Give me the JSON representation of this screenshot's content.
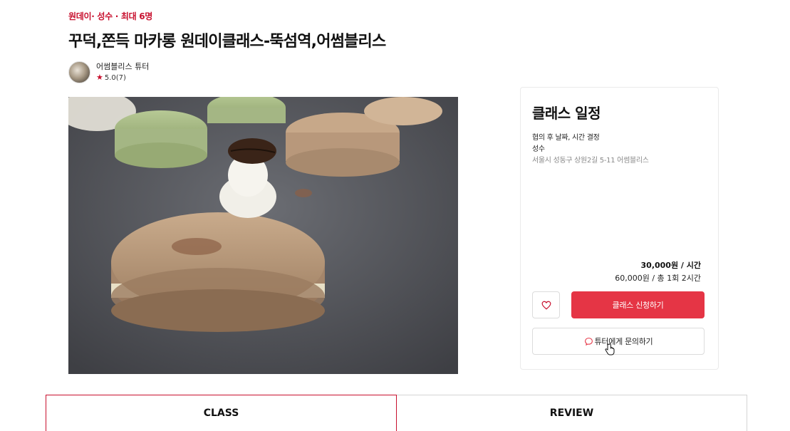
{
  "header": {
    "category": "원데이· 성수 · 최대 6명",
    "title": "꾸덕,쫀득 마카롱 원데이클래스-뚝섬역,어썸블리스"
  },
  "tutor": {
    "name": "어썸블리스 튜터",
    "rating": "5.0(7)"
  },
  "schedule": {
    "title": "클래스 일정",
    "date_note": "협의 후 날짜, 시간 결정",
    "area": "성수",
    "address": "서울시 성동구 상원2길 5-11 어썸블리스",
    "price_per_hour": "30,000원 / 시간",
    "price_total": "60,000원 / 총 1회 2시간",
    "apply_label": "클래스 신청하기",
    "ask_label": "튜터에게 문의하기"
  },
  "tabs": [
    {
      "label": "CLASS",
      "active": true
    },
    {
      "label": "REVIEW",
      "active": false
    }
  ],
  "colors": {
    "accent": "#e53545",
    "brand_red": "#c8102e"
  },
  "icons": [
    "star-icon",
    "heart-icon",
    "chat-bubble-icon",
    "hand-pointer-icon"
  ]
}
